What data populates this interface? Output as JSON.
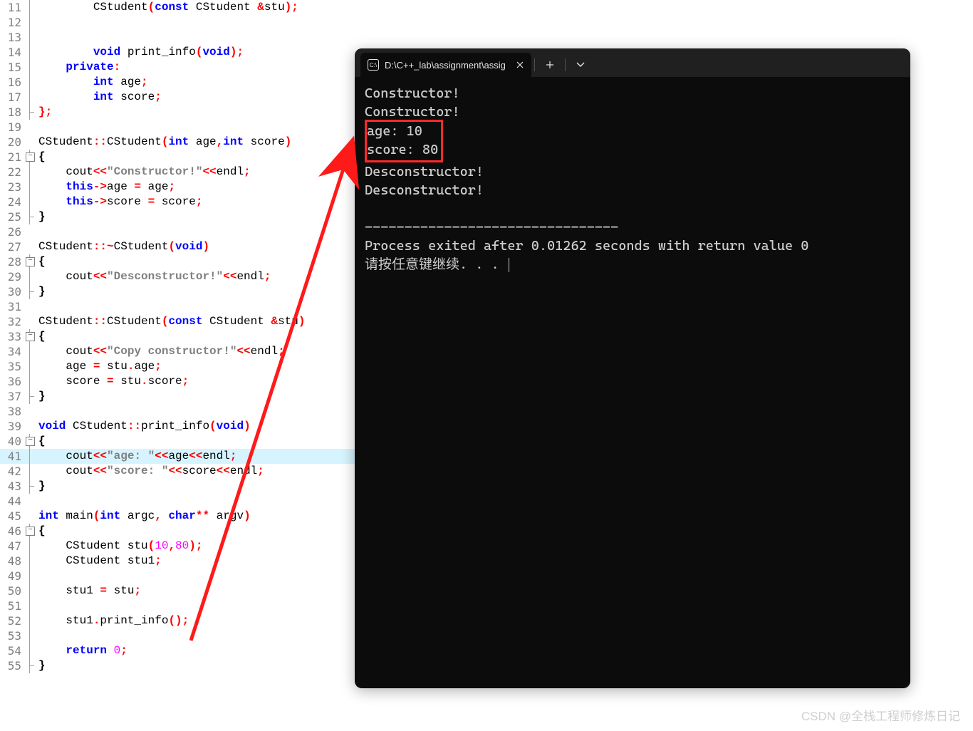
{
  "editor": {
    "lines": [
      {
        "n": 11,
        "fold": "line",
        "seg": [
          {
            "t": "        CStudent"
          },
          {
            "t": "(",
            "c": "op"
          },
          {
            "t": "const ",
            "c": "kw"
          },
          {
            "t": "CStudent "
          },
          {
            "t": "&",
            "c": "op"
          },
          {
            "t": "stu"
          },
          {
            "t": ");",
            "c": "op"
          }
        ]
      },
      {
        "n": 12,
        "fold": "line",
        "seg": []
      },
      {
        "n": 13,
        "fold": "line",
        "seg": []
      },
      {
        "n": 14,
        "fold": "line",
        "seg": [
          {
            "t": "        "
          },
          {
            "t": "void ",
            "c": "kw"
          },
          {
            "t": "print_info"
          },
          {
            "t": "(",
            "c": "op"
          },
          {
            "t": "void",
            "c": "kw"
          },
          {
            "t": ");",
            "c": "op"
          }
        ]
      },
      {
        "n": 15,
        "fold": "line",
        "seg": [
          {
            "t": "    "
          },
          {
            "t": "private",
            "c": "kw"
          },
          {
            "t": ":",
            "c": "op"
          }
        ]
      },
      {
        "n": 16,
        "fold": "line",
        "seg": [
          {
            "t": "        "
          },
          {
            "t": "int ",
            "c": "kw"
          },
          {
            "t": "age"
          },
          {
            "t": ";",
            "c": "op"
          }
        ]
      },
      {
        "n": 17,
        "fold": "line",
        "seg": [
          {
            "t": "        "
          },
          {
            "t": "int ",
            "c": "kw"
          },
          {
            "t": "score"
          },
          {
            "t": ";",
            "c": "op"
          }
        ]
      },
      {
        "n": 18,
        "fold": "end",
        "seg": [
          {
            "t": "};",
            "c": "op"
          }
        ]
      },
      {
        "n": 19,
        "fold": "none",
        "seg": []
      },
      {
        "n": 20,
        "fold": "none",
        "seg": [
          {
            "t": "CStudent"
          },
          {
            "t": "::",
            "c": "op"
          },
          {
            "t": "CStudent"
          },
          {
            "t": "(",
            "c": "op"
          },
          {
            "t": "int ",
            "c": "kw"
          },
          {
            "t": "age"
          },
          {
            "t": ",",
            "c": "op"
          },
          {
            "t": "int ",
            "c": "kw"
          },
          {
            "t": "score"
          },
          {
            "t": ")",
            "c": "op"
          }
        ]
      },
      {
        "n": 21,
        "fold": "box",
        "seg": [
          {
            "t": "{",
            "c": "br"
          }
        ]
      },
      {
        "n": 22,
        "fold": "line",
        "seg": [
          {
            "t": "    cout"
          },
          {
            "t": "<<",
            "c": "op"
          },
          {
            "t": "\"Constructor!\"",
            "c": "str"
          },
          {
            "t": "<<",
            "c": "op"
          },
          {
            "t": "endl"
          },
          {
            "t": ";",
            "c": "op"
          }
        ]
      },
      {
        "n": 23,
        "fold": "line",
        "seg": [
          {
            "t": "    "
          },
          {
            "t": "this",
            "c": "kw"
          },
          {
            "t": "->",
            "c": "op"
          },
          {
            "t": "age "
          },
          {
            "t": "= ",
            "c": "op"
          },
          {
            "t": "age"
          },
          {
            "t": ";",
            "c": "op"
          }
        ]
      },
      {
        "n": 24,
        "fold": "line",
        "seg": [
          {
            "t": "    "
          },
          {
            "t": "this",
            "c": "kw"
          },
          {
            "t": "->",
            "c": "op"
          },
          {
            "t": "score "
          },
          {
            "t": "= ",
            "c": "op"
          },
          {
            "t": "score"
          },
          {
            "t": ";",
            "c": "op"
          }
        ]
      },
      {
        "n": 25,
        "fold": "end",
        "seg": [
          {
            "t": "}",
            "c": "br"
          }
        ]
      },
      {
        "n": 26,
        "fold": "none",
        "seg": []
      },
      {
        "n": 27,
        "fold": "none",
        "seg": [
          {
            "t": "CStudent"
          },
          {
            "t": "::~",
            "c": "op"
          },
          {
            "t": "CStudent"
          },
          {
            "t": "(",
            "c": "op"
          },
          {
            "t": "void",
            "c": "kw"
          },
          {
            "t": ")",
            "c": "op"
          }
        ]
      },
      {
        "n": 28,
        "fold": "box",
        "seg": [
          {
            "t": "{",
            "c": "br"
          }
        ]
      },
      {
        "n": 29,
        "fold": "line",
        "seg": [
          {
            "t": "    cout"
          },
          {
            "t": "<<",
            "c": "op"
          },
          {
            "t": "\"Desconstructor!\"",
            "c": "str"
          },
          {
            "t": "<<",
            "c": "op"
          },
          {
            "t": "endl"
          },
          {
            "t": ";",
            "c": "op"
          }
        ]
      },
      {
        "n": 30,
        "fold": "end",
        "seg": [
          {
            "t": "}",
            "c": "br"
          }
        ]
      },
      {
        "n": 31,
        "fold": "none",
        "seg": []
      },
      {
        "n": 32,
        "fold": "none",
        "seg": [
          {
            "t": "CStudent"
          },
          {
            "t": "::",
            "c": "op"
          },
          {
            "t": "CStudent"
          },
          {
            "t": "(",
            "c": "op"
          },
          {
            "t": "const ",
            "c": "kw"
          },
          {
            "t": "CStudent "
          },
          {
            "t": "&",
            "c": "op"
          },
          {
            "t": "stu"
          },
          {
            "t": ")",
            "c": "op"
          }
        ]
      },
      {
        "n": 33,
        "fold": "box",
        "seg": [
          {
            "t": "{",
            "c": "br"
          }
        ]
      },
      {
        "n": 34,
        "fold": "line",
        "seg": [
          {
            "t": "    cout"
          },
          {
            "t": "<<",
            "c": "op"
          },
          {
            "t": "\"Copy constructor!\"",
            "c": "str"
          },
          {
            "t": "<<",
            "c": "op"
          },
          {
            "t": "endl"
          },
          {
            "t": ";",
            "c": "op"
          }
        ]
      },
      {
        "n": 35,
        "fold": "line",
        "seg": [
          {
            "t": "    age "
          },
          {
            "t": "= ",
            "c": "op"
          },
          {
            "t": "stu"
          },
          {
            "t": ".",
            "c": "op"
          },
          {
            "t": "age"
          },
          {
            "t": ";",
            "c": "op"
          }
        ]
      },
      {
        "n": 36,
        "fold": "line",
        "seg": [
          {
            "t": "    score "
          },
          {
            "t": "= ",
            "c": "op"
          },
          {
            "t": "stu"
          },
          {
            "t": ".",
            "c": "op"
          },
          {
            "t": "score"
          },
          {
            "t": ";",
            "c": "op"
          }
        ]
      },
      {
        "n": 37,
        "fold": "end",
        "seg": [
          {
            "t": "}",
            "c": "br"
          }
        ]
      },
      {
        "n": 38,
        "fold": "none",
        "seg": []
      },
      {
        "n": 39,
        "fold": "none",
        "seg": [
          {
            "t": "void ",
            "c": "kw"
          },
          {
            "t": "CStudent"
          },
          {
            "t": "::",
            "c": "op"
          },
          {
            "t": "print_info"
          },
          {
            "t": "(",
            "c": "op"
          },
          {
            "t": "void",
            "c": "kw"
          },
          {
            "t": ")",
            "c": "op"
          }
        ]
      },
      {
        "n": 40,
        "fold": "box",
        "seg": [
          {
            "t": "{",
            "c": "br"
          }
        ]
      },
      {
        "n": 41,
        "fold": "line",
        "hl": true,
        "seg": [
          {
            "t": "    cout"
          },
          {
            "t": "<<",
            "c": "op"
          },
          {
            "t": "\"age: \"",
            "c": "str"
          },
          {
            "t": "<<",
            "c": "op"
          },
          {
            "t": "age"
          },
          {
            "t": "<<",
            "c": "op"
          },
          {
            "t": "endl"
          },
          {
            "t": ";",
            "c": "op"
          }
        ]
      },
      {
        "n": 42,
        "fold": "line",
        "seg": [
          {
            "t": "    cout"
          },
          {
            "t": "<<",
            "c": "op"
          },
          {
            "t": "\"score: \"",
            "c": "str"
          },
          {
            "t": "<<",
            "c": "op"
          },
          {
            "t": "score"
          },
          {
            "t": "<<",
            "c": "op"
          },
          {
            "t": "endl"
          },
          {
            "t": ";",
            "c": "op"
          }
        ]
      },
      {
        "n": 43,
        "fold": "end",
        "seg": [
          {
            "t": "}",
            "c": "br"
          }
        ]
      },
      {
        "n": 44,
        "fold": "none",
        "seg": []
      },
      {
        "n": 45,
        "fold": "none",
        "seg": [
          {
            "t": "int ",
            "c": "kw"
          },
          {
            "t": "main"
          },
          {
            "t": "(",
            "c": "op"
          },
          {
            "t": "int ",
            "c": "kw"
          },
          {
            "t": "argc"
          },
          {
            "t": ", ",
            "c": "op"
          },
          {
            "t": "char",
            "c": "kw"
          },
          {
            "t": "** ",
            "c": "op"
          },
          {
            "t": "argv"
          },
          {
            "t": ")",
            "c": "op"
          }
        ]
      },
      {
        "n": 46,
        "fold": "box",
        "seg": [
          {
            "t": "{",
            "c": "br"
          }
        ]
      },
      {
        "n": 47,
        "fold": "line",
        "seg": [
          {
            "t": "    CStudent stu"
          },
          {
            "t": "(",
            "c": "op"
          },
          {
            "t": "10",
            "c": "num"
          },
          {
            "t": ",",
            "c": "op"
          },
          {
            "t": "80",
            "c": "num"
          },
          {
            "t": ");",
            "c": "op"
          }
        ]
      },
      {
        "n": 48,
        "fold": "line",
        "seg": [
          {
            "t": "    CStudent stu1"
          },
          {
            "t": ";",
            "c": "op"
          }
        ]
      },
      {
        "n": 49,
        "fold": "line",
        "seg": []
      },
      {
        "n": 50,
        "fold": "line",
        "seg": [
          {
            "t": "    stu1 "
          },
          {
            "t": "= ",
            "c": "op"
          },
          {
            "t": "stu"
          },
          {
            "t": ";",
            "c": "op"
          }
        ]
      },
      {
        "n": 51,
        "fold": "line",
        "seg": []
      },
      {
        "n": 52,
        "fold": "line",
        "seg": [
          {
            "t": "    stu1"
          },
          {
            "t": ".",
            "c": "op"
          },
          {
            "t": "print_info"
          },
          {
            "t": "();",
            "c": "op"
          }
        ]
      },
      {
        "n": 53,
        "fold": "line",
        "seg": []
      },
      {
        "n": 54,
        "fold": "line",
        "seg": [
          {
            "t": "    "
          },
          {
            "t": "return ",
            "c": "kw"
          },
          {
            "t": "0",
            "c": "num"
          },
          {
            "t": ";",
            "c": "op"
          }
        ]
      },
      {
        "n": 55,
        "fold": "end",
        "seg": [
          {
            "t": "}",
            "c": "br"
          }
        ]
      }
    ]
  },
  "terminal": {
    "tab_title": "D:\\C++_lab\\assignment\\assig",
    "tab_icon_text": "C:\\",
    "output": {
      "line1": "Constructor!",
      "line2": "Constructor!",
      "boxed_line1": "age: 10",
      "boxed_line2": "score: 80",
      "line5": "Desconstructor!",
      "line6": "Desconstructor!",
      "sep": "--------------------------------",
      "exit": "Process exited after 0.01262 seconds with return value 0",
      "prompt": "请按任意键继续. . . "
    }
  },
  "watermark": "CSDN @全栈工程师修炼日记"
}
